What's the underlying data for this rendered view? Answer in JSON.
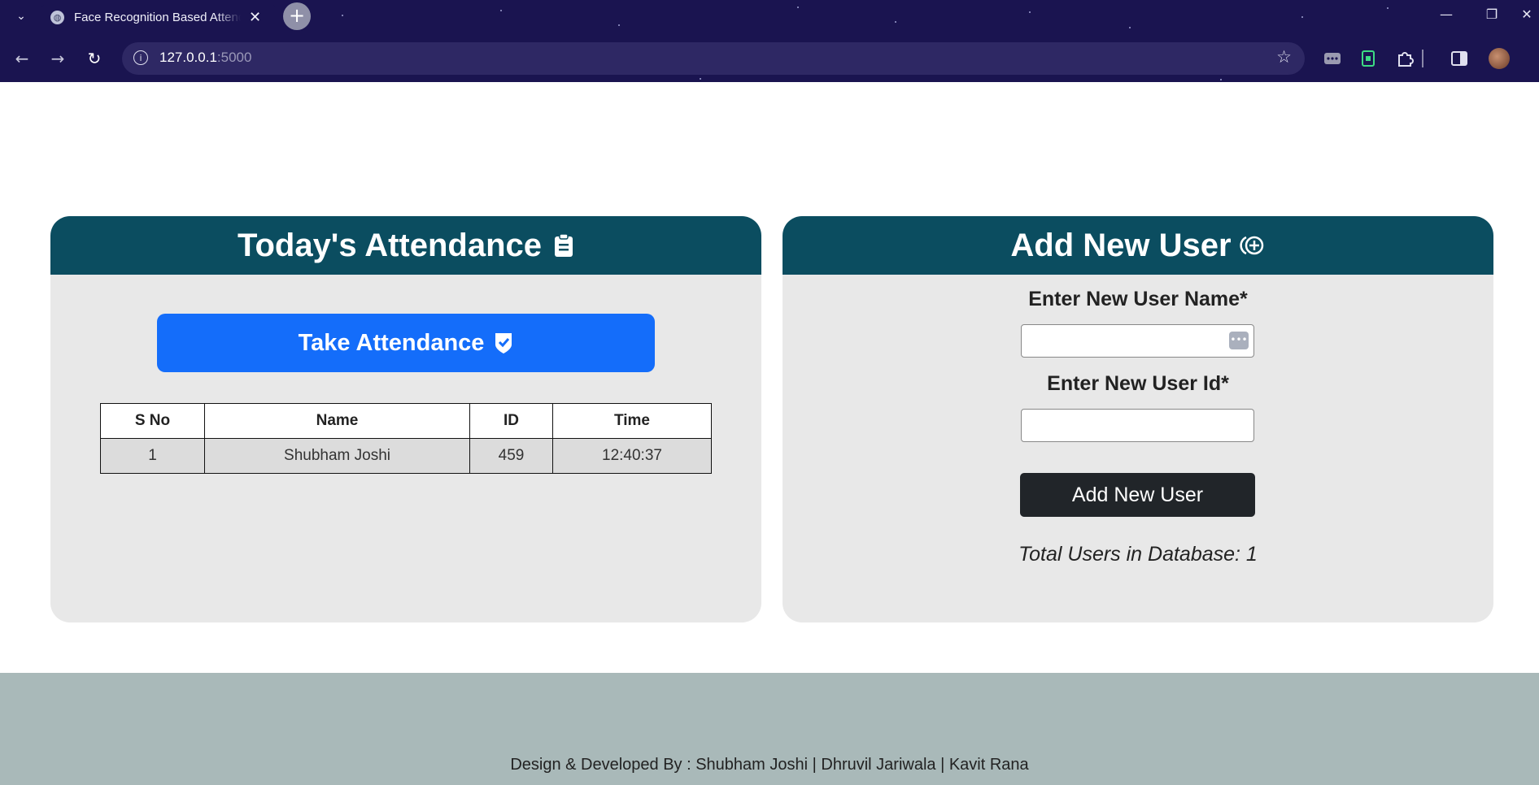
{
  "browser": {
    "tab_title": "Face Recognition Based Attendance System",
    "url_host": "127.0.0.1",
    "url_port": ":5000",
    "newtab_symbol": "+",
    "tab_close_symbol": "✕",
    "tabstrip_symbol": "⌄",
    "nav": {
      "back": "←",
      "forward": "→",
      "reload": "↻"
    },
    "window": {
      "minimize": "—",
      "restore": "❐",
      "close": "✕"
    },
    "bookmark_symbol": "☆",
    "icons": [
      "tabstrip-menu-icon",
      "globe-icon",
      "info-icon",
      "star-icon",
      "password-manager-icon",
      "extension-evernote-icon",
      "puzzle-icon",
      "side-panel-icon",
      "avatar"
    ]
  },
  "attendance": {
    "title": "Today's Attendance",
    "title_icon": "clipboard-icon",
    "take_button": "Take Attendance",
    "take_button_icon": "shield-check-icon",
    "columns": [
      "S No",
      "Name",
      "ID",
      "Time"
    ],
    "rows": [
      {
        "sno": "1",
        "name": "Shubham Joshi",
        "id": "459",
        "time": "12:40:37"
      }
    ]
  },
  "add_user": {
    "title": "Add New User",
    "title_icon": "add-circle-icon",
    "name_label": "Enter New User Name*",
    "id_label": "Enter New User Id*",
    "name_value": "",
    "id_value": "",
    "button": "Add New User",
    "total_label": "Total Users in Database: 1"
  },
  "footer": {
    "text": "Design & Developed By : Shubham Joshi | Dhruvil Jariwala | Kavit Rana"
  },
  "colors": {
    "chrome_bg": "#1a1450",
    "card_header": "#0b4d60",
    "card_bg": "#e8e8e8",
    "primary_button": "#146dfa",
    "dark_button": "#212529",
    "footer_bg": "#a9b9b9"
  }
}
